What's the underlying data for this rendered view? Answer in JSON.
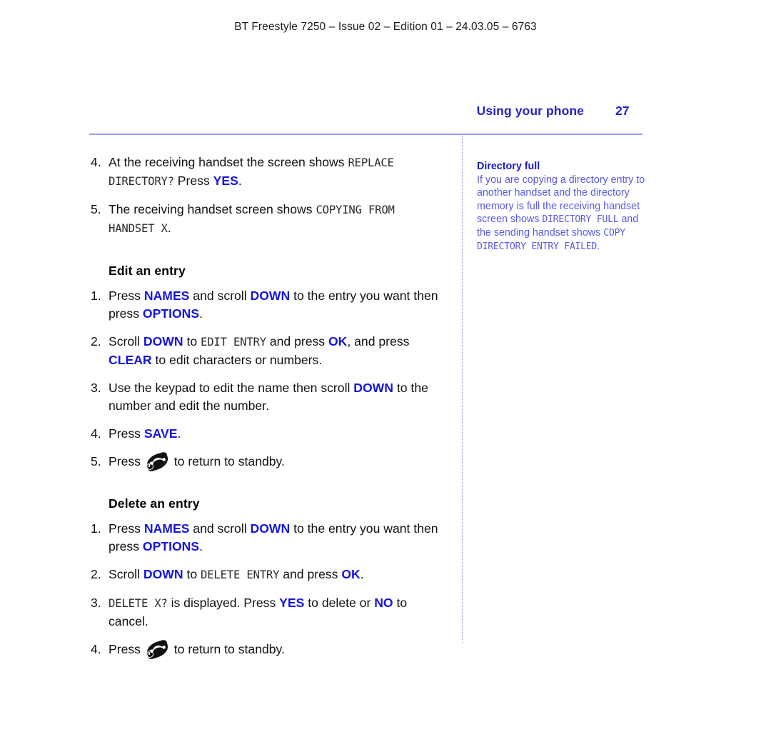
{
  "running_head": "BT Freestyle 7250 – Issue 02 – Edition 01 – 24.03.05 – 6763",
  "header": {
    "chapter_title": "Using your phone",
    "page_number": "27",
    "accent_color": "#2222cc",
    "rule_color": "#9a9aee"
  },
  "main": {
    "continued_steps": [
      {
        "num": "4.",
        "parts": [
          {
            "text": "At the receiving handset the screen shows ",
            "style": "plain"
          },
          {
            "text": "REPLACE DIRECTORY?",
            "style": "lcd"
          },
          {
            "text": " Press ",
            "style": "plain"
          },
          {
            "text": "YES",
            "style": "key"
          },
          {
            "text": ".",
            "style": "plain"
          }
        ]
      },
      {
        "num": "5.",
        "parts": [
          {
            "text": "The receiving handset screen shows ",
            "style": "plain"
          },
          {
            "text": "COPYING FROM HANDSET X",
            "style": "lcd"
          },
          {
            "text": ".",
            "style": "plain"
          }
        ]
      }
    ],
    "sections": [
      {
        "heading": "Edit an entry",
        "steps": [
          {
            "num": "1.",
            "parts": [
              {
                "text": "Press ",
                "style": "plain"
              },
              {
                "text": "NAMES",
                "style": "key"
              },
              {
                "text": " and scroll ",
                "style": "plain"
              },
              {
                "text": "DOWN",
                "style": "key"
              },
              {
                "text": " to the entry you want then press ",
                "style": "plain"
              },
              {
                "text": "OPTIONS",
                "style": "key"
              },
              {
                "text": ".",
                "style": "plain"
              }
            ]
          },
          {
            "num": "2.",
            "parts": [
              {
                "text": "Scroll ",
                "style": "plain"
              },
              {
                "text": "DOWN",
                "style": "key"
              },
              {
                "text": " to ",
                "style": "plain"
              },
              {
                "text": "EDIT ENTRY",
                "style": "lcd"
              },
              {
                "text": " and press ",
                "style": "plain"
              },
              {
                "text": "OK",
                "style": "key"
              },
              {
                "text": ", and press ",
                "style": "plain"
              },
              {
                "text": "CLEAR",
                "style": "key"
              },
              {
                "text": " to edit characters or numbers.",
                "style": "plain"
              }
            ]
          },
          {
            "num": "3.",
            "parts": [
              {
                "text": "Use the keypad to edit the name then scroll ",
                "style": "plain"
              },
              {
                "text": "DOWN",
                "style": "key"
              },
              {
                "text": " to the number and edit the number.",
                "style": "plain"
              }
            ]
          },
          {
            "num": "4.",
            "parts": [
              {
                "text": "Press ",
                "style": "plain"
              },
              {
                "text": "SAVE",
                "style": "key"
              },
              {
                "text": ".",
                "style": "plain"
              }
            ]
          },
          {
            "num": "5.",
            "parts": [
              {
                "text": "Press ",
                "style": "plain"
              },
              {
                "text": "",
                "style": "icon",
                "icon": "hangup-standby-icon"
              },
              {
                "text": " to return to standby.",
                "style": "plain"
              }
            ]
          }
        ]
      },
      {
        "heading": "Delete an entry",
        "steps": [
          {
            "num": "1.",
            "parts": [
              {
                "text": "Press ",
                "style": "plain"
              },
              {
                "text": "NAMES",
                "style": "key"
              },
              {
                "text": " and scroll ",
                "style": "plain"
              },
              {
                "text": "DOWN",
                "style": "key"
              },
              {
                "text": " to the entry you want then press ",
                "style": "plain"
              },
              {
                "text": "OPTIONS",
                "style": "key"
              },
              {
                "text": ".",
                "style": "plain"
              }
            ]
          },
          {
            "num": "2.",
            "parts": [
              {
                "text": "Scroll ",
                "style": "plain"
              },
              {
                "text": "DOWN",
                "style": "key"
              },
              {
                "text": " to ",
                "style": "plain"
              },
              {
                "text": "DELETE ENTRY",
                "style": "lcd"
              },
              {
                "text": " and press ",
                "style": "plain"
              },
              {
                "text": "OK",
                "style": "key"
              },
              {
                "text": ".",
                "style": "plain"
              }
            ]
          },
          {
            "num": "3.",
            "parts": [
              {
                "text": "",
                "style": "plain"
              },
              {
                "text": "DELETE X?",
                "style": "lcd"
              },
              {
                "text": " is displayed. Press ",
                "style": "plain"
              },
              {
                "text": "YES",
                "style": "key"
              },
              {
                "text": " to delete or ",
                "style": "plain"
              },
              {
                "text": "NO",
                "style": "key"
              },
              {
                "text": " to cancel.",
                "style": "plain"
              }
            ]
          },
          {
            "num": "4.",
            "parts": [
              {
                "text": "Press ",
                "style": "plain"
              },
              {
                "text": "",
                "style": "icon",
                "icon": "hangup-standby-icon"
              },
              {
                "text": " to return to standby.",
                "style": "plain"
              }
            ]
          }
        ]
      }
    ]
  },
  "side_note": {
    "title": "Directory full",
    "title_color": "#1a1ac0",
    "body_color": "#5a5ae6",
    "parts": [
      {
        "text": "If you are copying a directory entry to another handset and the directory memory is full the receiving handset screen shows ",
        "style": "plain"
      },
      {
        "text": "DIRECTORY FULL",
        "style": "lcd"
      },
      {
        "text": " and the sending handset shows ",
        "style": "plain"
      },
      {
        "text": "COPY DIRECTORY ENTRY FAILED",
        "style": "lcd"
      },
      {
        "text": ".",
        "style": "plain"
      }
    ]
  }
}
